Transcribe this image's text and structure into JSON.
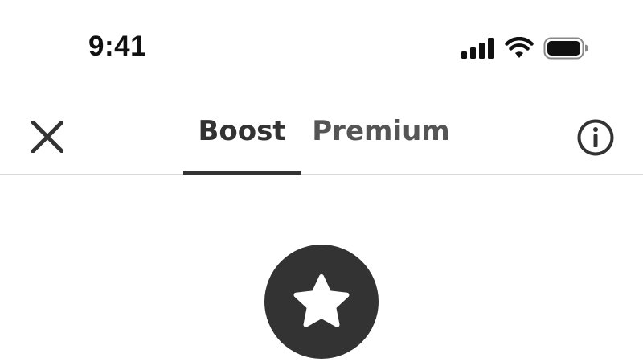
{
  "status_bar": {
    "time": "9:41",
    "icons": [
      "signal-icon",
      "wifi-icon",
      "battery-icon"
    ]
  },
  "header": {
    "close_icon": "close-icon",
    "info_icon": "info-icon",
    "tabs": [
      {
        "label": "Boost",
        "active": true
      },
      {
        "label": "Premium",
        "active": false
      }
    ]
  },
  "hero": {
    "icon": "star-icon"
  },
  "colors": {
    "text_primary": "#333333",
    "text_secondary": "#555555",
    "divider": "#d9d9d9",
    "badge": "#333333",
    "background": "#ffffff"
  }
}
